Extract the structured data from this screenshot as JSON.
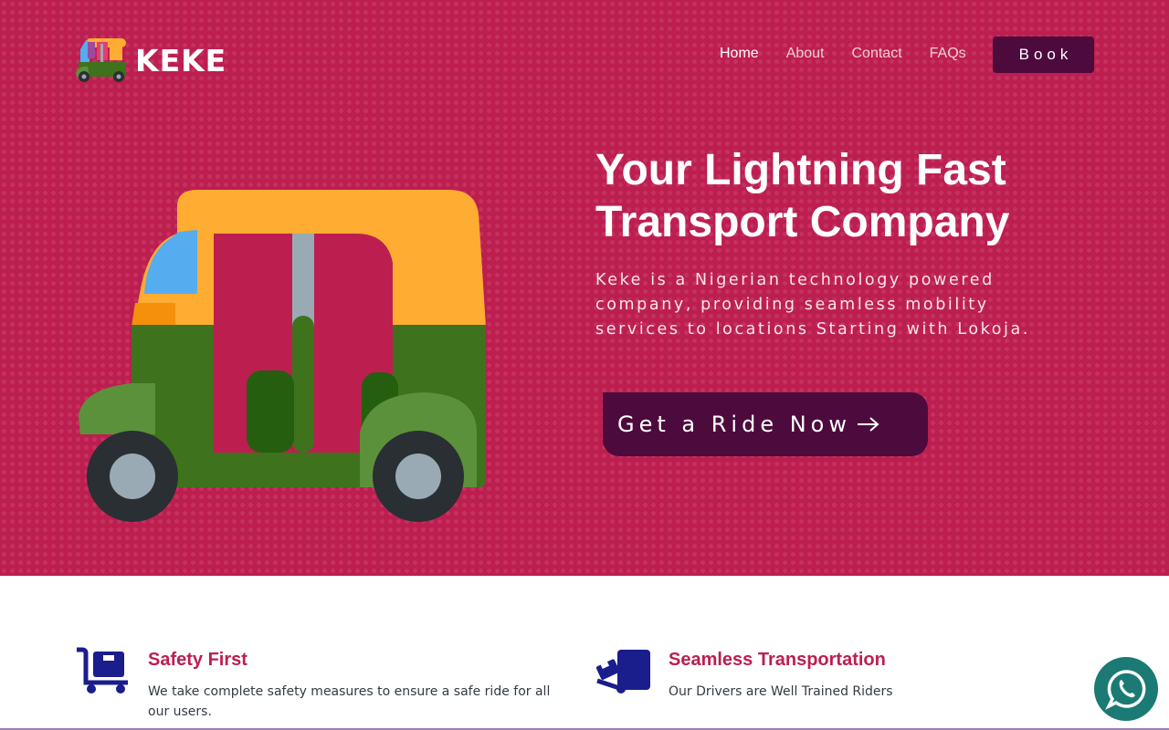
{
  "brand": {
    "name": "KEKE"
  },
  "nav": {
    "items": [
      {
        "label": "Home",
        "active": true
      },
      {
        "label": "About",
        "active": false
      },
      {
        "label": "Contact",
        "active": false
      },
      {
        "label": "FAQs",
        "active": false
      }
    ],
    "book_label": "Book"
  },
  "hero": {
    "title_line1": "Your Lightning Fast",
    "title_line2": "Transport Company",
    "description": "Keke is a Nigerian technology powered company, providing seamless mobility services to locations Starting with Lokoja.",
    "cta_label": "Get a Ride Now",
    "cta_icon": "arrow-right-icon"
  },
  "features": [
    {
      "icon": "luggage-cart-icon",
      "title": "Safety First",
      "text": "We take complete safety measures to ensure a safe ride for all our users."
    },
    {
      "icon": "delivery-dolly-icon",
      "title": "Seamless Transportation",
      "text": "Our Drivers are Well Trained Riders"
    }
  ],
  "whatsapp": {
    "icon": "whatsapp-icon"
  },
  "colors": {
    "hero_bg": "#bd1e50",
    "button_bg": "#4d0a3d",
    "accent_title": "#bd1e50",
    "feature_icon": "#1a1d8c",
    "whatsapp": "#1b7a73"
  }
}
